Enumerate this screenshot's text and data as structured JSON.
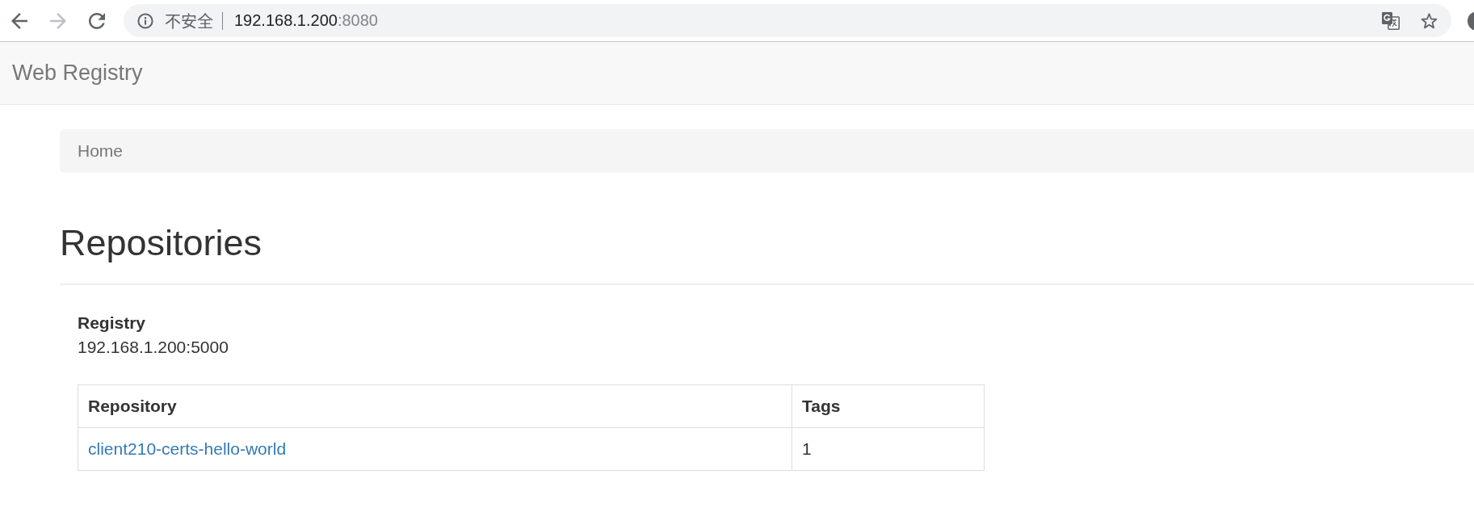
{
  "toolbar": {
    "nav_buttons": [
      {
        "kind": "back",
        "disabled": false
      },
      {
        "kind": "forward",
        "disabled": true
      },
      {
        "kind": "reload",
        "disabled": false
      }
    ],
    "address_bar": {
      "security_label": "不安全",
      "url_host": "192.168.1.200",
      "url_port": ":8080"
    }
  },
  "navbar": {
    "brand": "Web Registry"
  },
  "breadcrumb": [
    {
      "label": "Home",
      "active": true
    }
  ],
  "page_title": "Repositories",
  "registry": {
    "label": "Registry",
    "value": "192.168.1.200:5000"
  },
  "table": {
    "columns": [
      {
        "label": "Repository",
        "kind": "link"
      },
      {
        "label": "Tags",
        "kind": "text"
      }
    ],
    "rows": [
      [
        "client210-certs-hello-world",
        "1"
      ]
    ]
  }
}
